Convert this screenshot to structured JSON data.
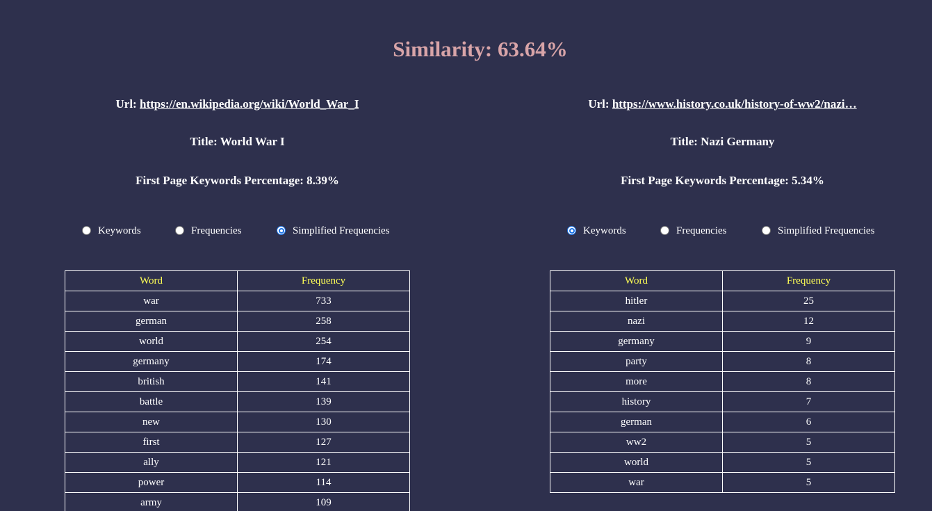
{
  "heading": "Similarity: 63.64%",
  "left": {
    "url_label": "Url: ",
    "url": "https://en.wikipedia.org/wiki/World_War_I",
    "title": "Title: World War I",
    "keywords_percentage": "First Page Keywords Percentage: 8.39%",
    "radios": [
      {
        "label": "Keywords",
        "checked": false
      },
      {
        "label": "Frequencies",
        "checked": false
      },
      {
        "label": "Simplified Frequencies",
        "checked": true
      }
    ],
    "table": {
      "headers": [
        "Word",
        "Frequency"
      ],
      "rows": [
        [
          "war",
          "733"
        ],
        [
          "german",
          "258"
        ],
        [
          "world",
          "254"
        ],
        [
          "germany",
          "174"
        ],
        [
          "british",
          "141"
        ],
        [
          "battle",
          "139"
        ],
        [
          "new",
          "130"
        ],
        [
          "first",
          "127"
        ],
        [
          "ally",
          "121"
        ],
        [
          "power",
          "114"
        ],
        [
          "army",
          "109"
        ]
      ]
    }
  },
  "right": {
    "url_label": "Url: ",
    "url": "https://www.history.co.uk/history-of-ww2/nazi…",
    "title": "Title: Nazi Germany",
    "keywords_percentage": "First Page Keywords Percentage: 5.34%",
    "radios": [
      {
        "label": "Keywords",
        "checked": true
      },
      {
        "label": "Frequencies",
        "checked": false
      },
      {
        "label": "Simplified Frequencies",
        "checked": false
      }
    ],
    "table": {
      "headers": [
        "Word",
        "Frequency"
      ],
      "rows": [
        [
          "hitler",
          "25"
        ],
        [
          "nazi",
          "12"
        ],
        [
          "germany",
          "9"
        ],
        [
          "party",
          "8"
        ],
        [
          "more",
          "8"
        ],
        [
          "history",
          "7"
        ],
        [
          "german",
          "6"
        ],
        [
          "ww2",
          "5"
        ],
        [
          "world",
          "5"
        ],
        [
          "war",
          "5"
        ]
      ]
    }
  },
  "colors": {
    "background": "#2e304d",
    "heading": "#d8a4a8",
    "table_header": "#ffff55",
    "radio_checked": "#1a73e8"
  }
}
